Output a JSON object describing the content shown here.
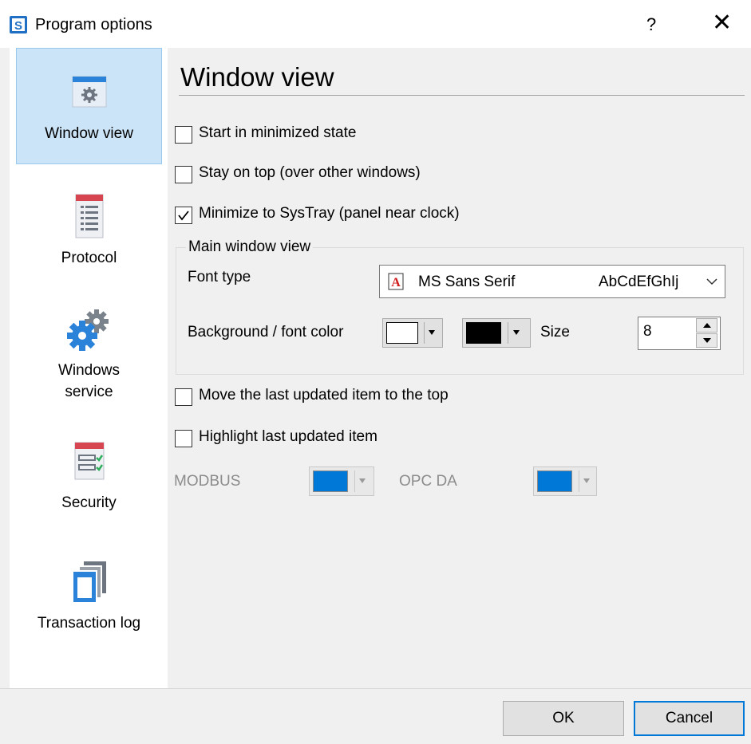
{
  "window": {
    "title": "Program options",
    "help": "?",
    "close": "✕"
  },
  "sidebar": {
    "items": [
      {
        "label": "Window view",
        "icon": "window-gear-icon",
        "selected": true
      },
      {
        "label": "Protocol",
        "icon": "protocol-list-icon",
        "selected": false
      },
      {
        "label": "Windows\nservice",
        "icon": "gears-icon",
        "selected": false
      },
      {
        "label": "Security",
        "icon": "security-checklist-icon",
        "selected": false
      },
      {
        "label": "Transaction log",
        "icon": "stacked-windows-icon",
        "selected": false
      }
    ]
  },
  "page": {
    "title": "Window view",
    "options": [
      {
        "label": "Start in minimized state",
        "checked": false
      },
      {
        "label": "Stay on top (over other windows)",
        "checked": false
      },
      {
        "label": "Minimize to SysTray (panel near clock)",
        "checked": true
      }
    ],
    "group": {
      "legend": "Main window view",
      "font_type_label": "Font type",
      "font_name": "MS Sans Serif",
      "font_sample": "AbCdEfGhIj",
      "color_label": "Background / font color",
      "background_color": "#ffffff",
      "font_color": "#000000",
      "size_label": "Size",
      "size_value": "8"
    },
    "options2": [
      {
        "label": "Move the last updated item to the top",
        "checked": false
      },
      {
        "label": "Highlight last updated item",
        "checked": false
      }
    ],
    "highlight": {
      "modbus_label": "MODBUS",
      "modbus_color": "#0078d7",
      "opcda_label": "OPC DA",
      "opcda_color": "#0078d7"
    }
  },
  "buttons": {
    "ok": "OK",
    "cancel": "Cancel"
  }
}
